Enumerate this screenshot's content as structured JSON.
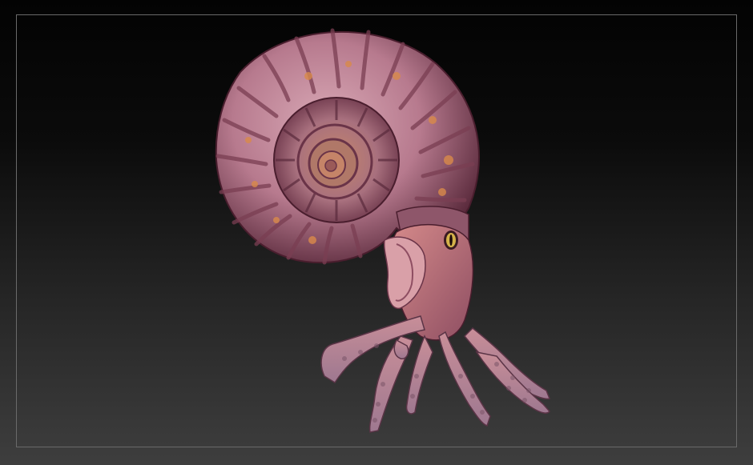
{
  "viewport": {
    "background_top": "#030303",
    "background_bottom": "#3e3e3e",
    "frame_color": "#6a6a6a"
  },
  "model": {
    "subject": "ammonite-sculpt",
    "shell_color": "#c58a9c",
    "shell_shadow": "#5a2a3c",
    "shell_highlight": "#e9c4cf",
    "rib_color": "#a66a80",
    "spot_color": "#d98a4a",
    "body_color": "#c57a85",
    "tentacle_color": "#b88a98",
    "eye_color": "#d4b24a"
  }
}
